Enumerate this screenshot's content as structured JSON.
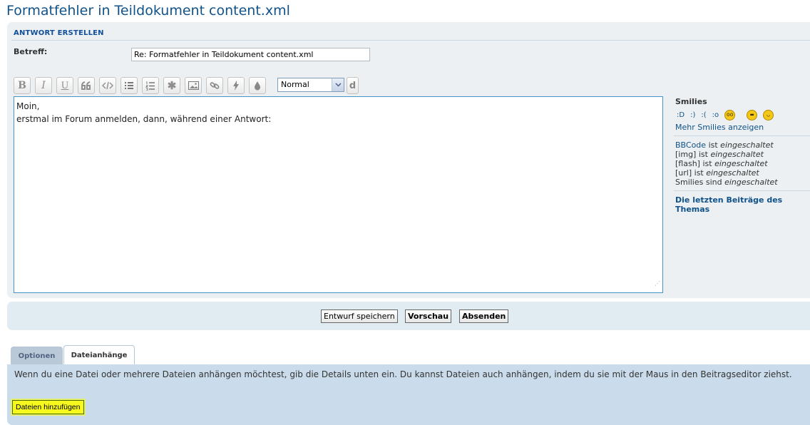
{
  "page": {
    "title": "Formatfehler in Teildokument content.xml"
  },
  "reply": {
    "heading": "ANTWORT ERSTELLEN",
    "subject_label": "Betreff:",
    "subject_value": "Re: Formatfehler in Teildokument content.xml"
  },
  "toolbar": {
    "bold": "B",
    "italic": "I",
    "underline": "U",
    "font_size": "Normal",
    "extra": "d"
  },
  "editor": {
    "line1": "Moin,",
    "line2": "erstmal im Forum anmelden, dann, während einer Antwort:"
  },
  "sidebar": {
    "smilies_title": "Smilies",
    "smilies": [
      ":D",
      ":)",
      ":(",
      ":o"
    ],
    "smiley_q": ":?",
    "more_smilies": "Mehr Smilies anzeigen",
    "bbcode_link": "BBCode",
    "is_text": "ist",
    "enabled": "eingeschaltet",
    "img": "[img]",
    "flash": "[flash]",
    "url": "[url]",
    "smilies_are": "Smilies sind",
    "recent_posts": "Die letzten Beiträge des Themas"
  },
  "actions": {
    "save_draft": "Entwurf speichern",
    "preview": "Vorschau",
    "submit": "Absenden"
  },
  "tabs": {
    "options": "Optionen",
    "attachments": "Dateianhänge"
  },
  "attachments": {
    "info": "Wenn du eine Datei oder mehrere Dateien anhängen möchtest, gib die Details unten ein. Du kannst Dateien auch anhängen, indem du sie mit der Maus in den Beitragseditor ziehst.",
    "add_files": "Dateien hinzufügen"
  },
  "colors": {
    "accent": "#105289",
    "editor_border": "#4594c6",
    "highlight": "#f7f91e"
  }
}
